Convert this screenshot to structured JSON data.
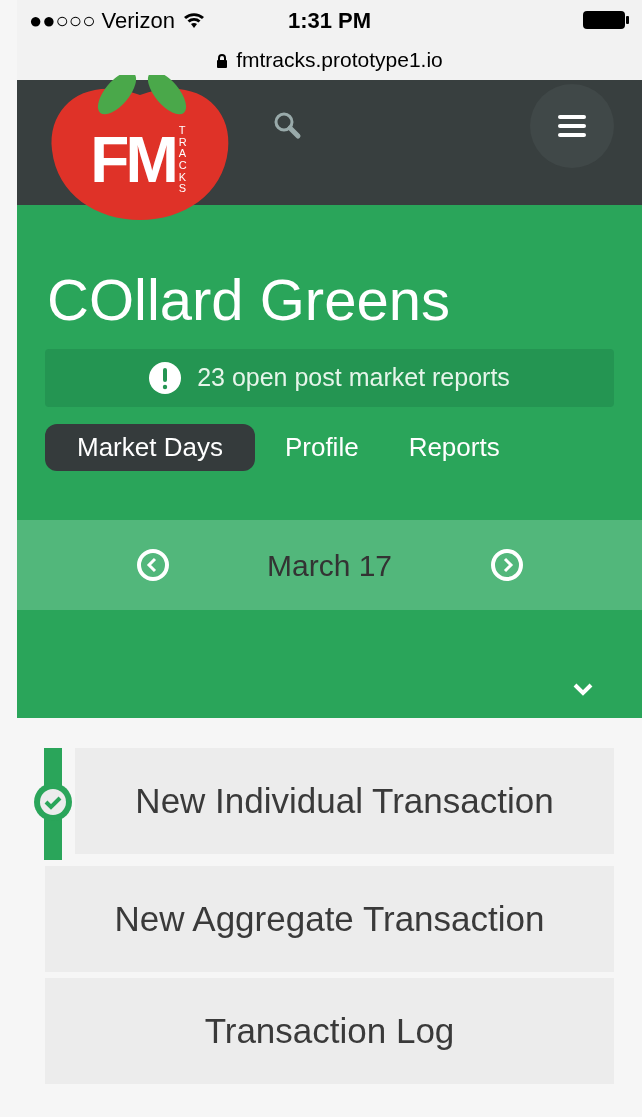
{
  "status_bar": {
    "carrier": "●●○○○ Verizon",
    "time": "1:31 PM"
  },
  "url_bar": {
    "url": "fmtracks.prototype1.io"
  },
  "logo": {
    "main": "FM",
    "sub": "TRACKS"
  },
  "title": "COllard Greens",
  "alert": {
    "text": "23 open post market reports"
  },
  "tabs": [
    {
      "label": "Market Days",
      "selected": true
    },
    {
      "label": "Profile",
      "selected": false
    },
    {
      "label": "Reports",
      "selected": false
    }
  ],
  "date_nav": {
    "date": "March 17"
  },
  "actions": [
    {
      "label": "New Individual Transaction",
      "selected": true
    },
    {
      "label": "New Aggregate Transaction",
      "selected": false
    },
    {
      "label": "Transaction Log",
      "selected": false
    }
  ]
}
